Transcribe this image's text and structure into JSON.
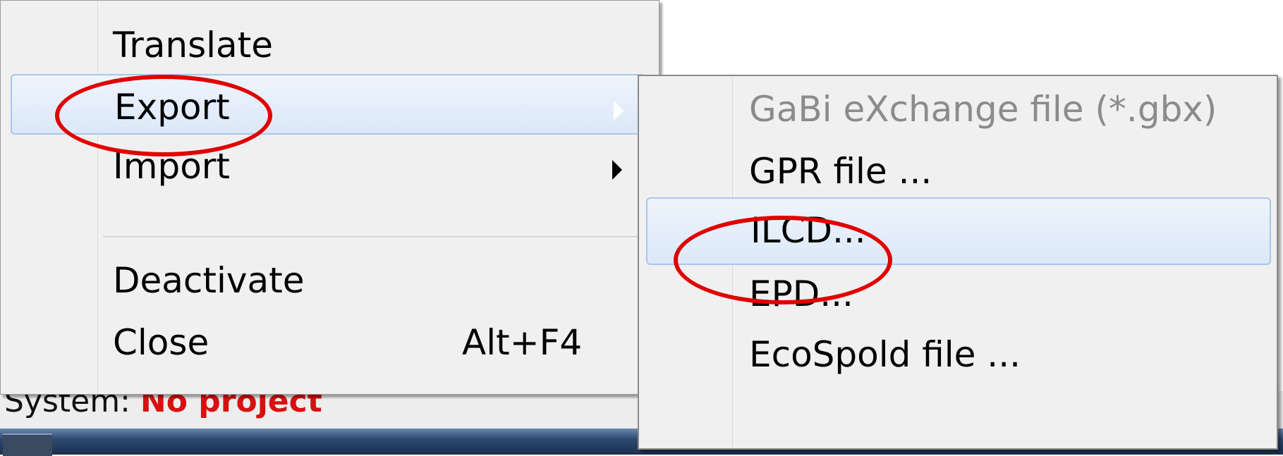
{
  "context_menu": {
    "items": [
      {
        "label": "Translate",
        "shortcut": "",
        "has_submenu": false
      },
      {
        "label": "Export",
        "shortcut": "",
        "has_submenu": true,
        "highlighted": true
      },
      {
        "label": "Import",
        "shortcut": "",
        "has_submenu": true
      },
      {
        "label": "Deactivate",
        "shortcut": "",
        "has_submenu": false
      },
      {
        "label": "Close",
        "shortcut": "Alt+F4",
        "has_submenu": false
      }
    ]
  },
  "export_submenu": {
    "items": [
      {
        "label": "GaBi eXchange file (*.gbx)",
        "disabled": true
      },
      {
        "label": "GPR file ..."
      },
      {
        "label": "ILCD...",
        "highlighted": true
      },
      {
        "label": "EPD..."
      },
      {
        "label": "EcoSpold file ..."
      }
    ]
  },
  "status_bar": {
    "prefix": "System:",
    "project": "No project"
  },
  "colors": {
    "annotation": "#e00000",
    "highlight_border": "#a9c6ec",
    "menu_background": "#f0f0f0",
    "disabled_text": "#8b8b8b",
    "status_project": "#d81010"
  },
  "icons": [
    "submenu-arrow-icon"
  ]
}
